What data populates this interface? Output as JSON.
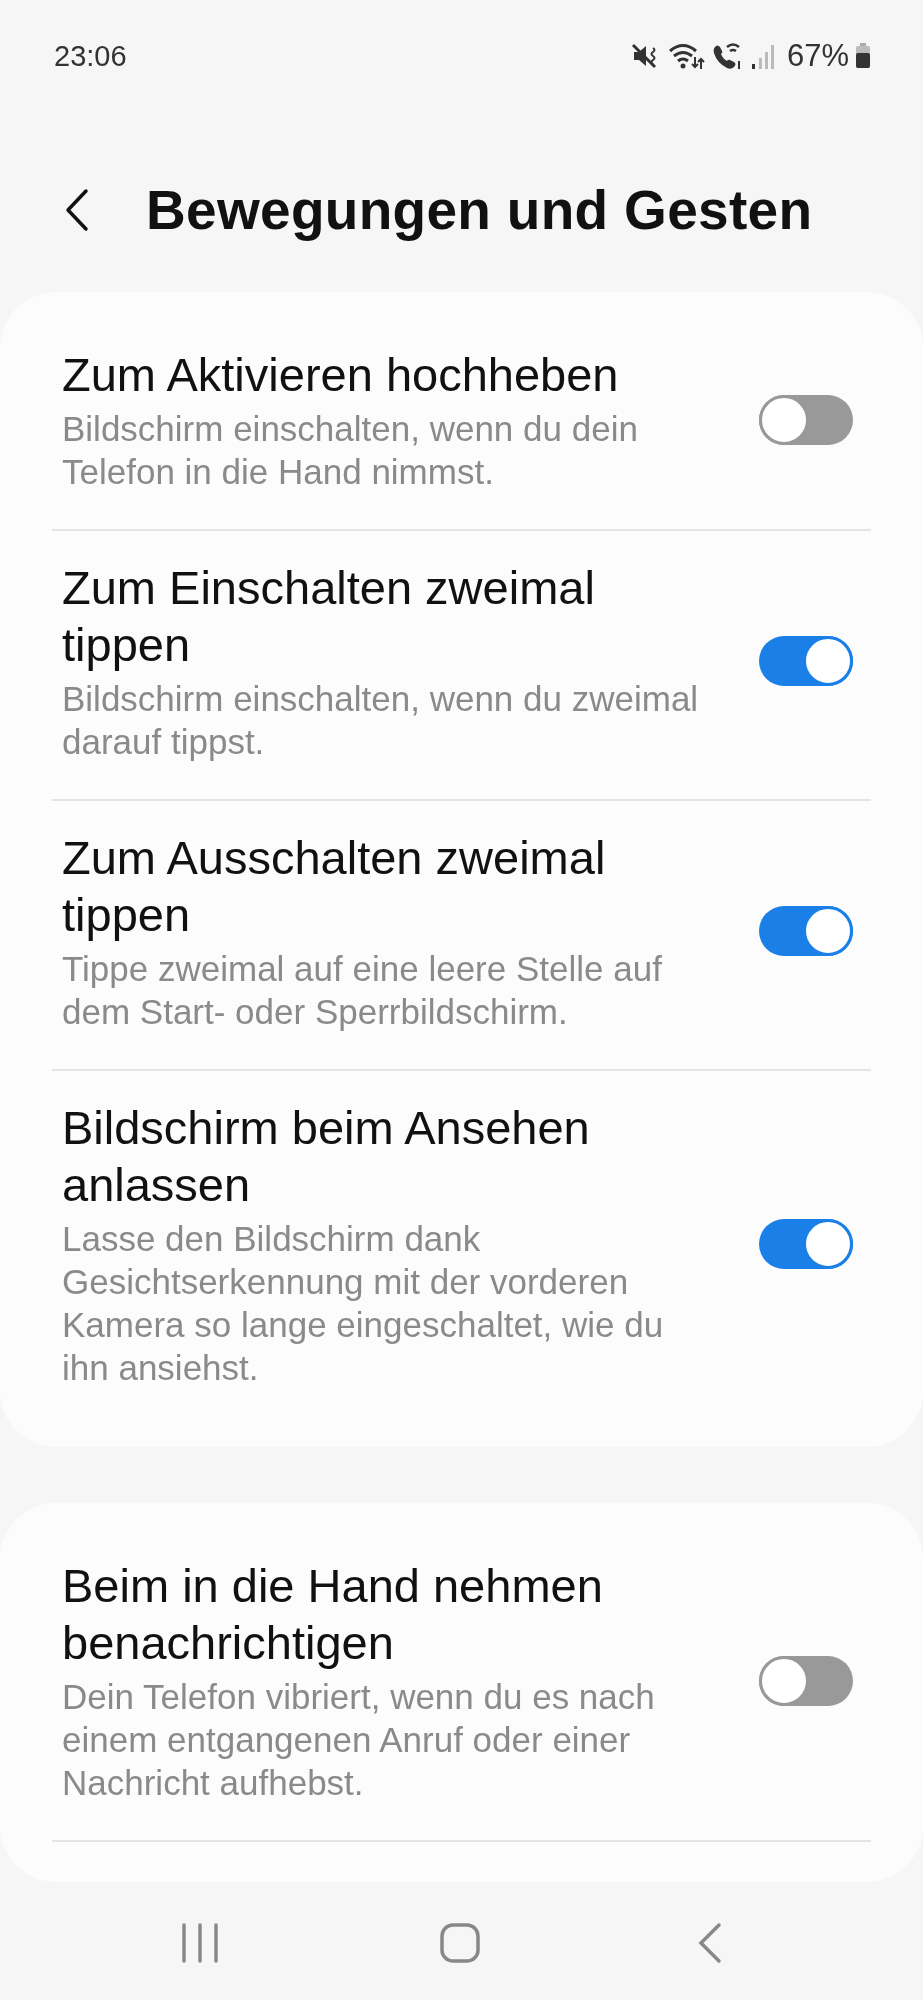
{
  "status_bar": {
    "time": "23:06",
    "battery": "67%"
  },
  "header": {
    "title": "Bewegungen und Gesten"
  },
  "sections": [
    {
      "continues": false,
      "items": [
        {
          "title": "Zum Aktivieren hochheben",
          "description": "Bildschirm einschalten, wenn du dein Telefon in die Hand nimmst.",
          "on": false
        },
        {
          "title": "Zum Einschalten zweimal tippen",
          "description": "Bildschirm einschalten, wenn du zweimal darauf tippst.",
          "on": true
        },
        {
          "title": "Zum Ausschalten zweimal tippen",
          "description": "Tippe zweimal auf eine leere Stelle auf dem Start- oder Sperrbildschirm.",
          "on": true
        },
        {
          "title": "Bildschirm beim Ansehen anlassen",
          "description": "Lasse den Bildschirm dank Gesichtserkennung mit der vorderen Kamera so lange eingeschaltet, wie du ihn ansiehst.",
          "on": true
        }
      ]
    },
    {
      "continues": true,
      "items": [
        {
          "title": "Beim in die Hand nehmen benachrichtigen",
          "description": "Dein Telefon vibriert, wenn du es nach einem entgangenen Anruf oder einer Nachricht aufhebst.",
          "on": false
        }
      ]
    }
  ]
}
